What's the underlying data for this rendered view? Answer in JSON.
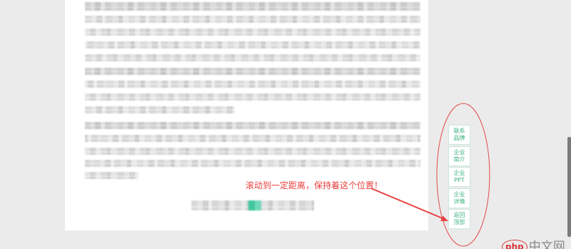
{
  "floating_menu": {
    "items": [
      {
        "line1": "联系",
        "line2": "品牌"
      },
      {
        "line1": "企业",
        "line2": "简介"
      },
      {
        "line1": "企业",
        "line2": "PPT"
      },
      {
        "line1": "企业",
        "line2": "详情"
      },
      {
        "line1": "返回",
        "line2": "顶部"
      }
    ]
  },
  "annotation": {
    "text": "滚动到一定距离，保持着这个位置！"
  },
  "watermark": {
    "brand": "php",
    "name": "中文网"
  },
  "colors": {
    "page_background": "#ebebeb",
    "content_background": "#ffffff",
    "menu_text": "#3bb37d",
    "menu_border": "#cde8da",
    "annotation_red": "#e8403f",
    "watermark_red": "#d8383a"
  }
}
